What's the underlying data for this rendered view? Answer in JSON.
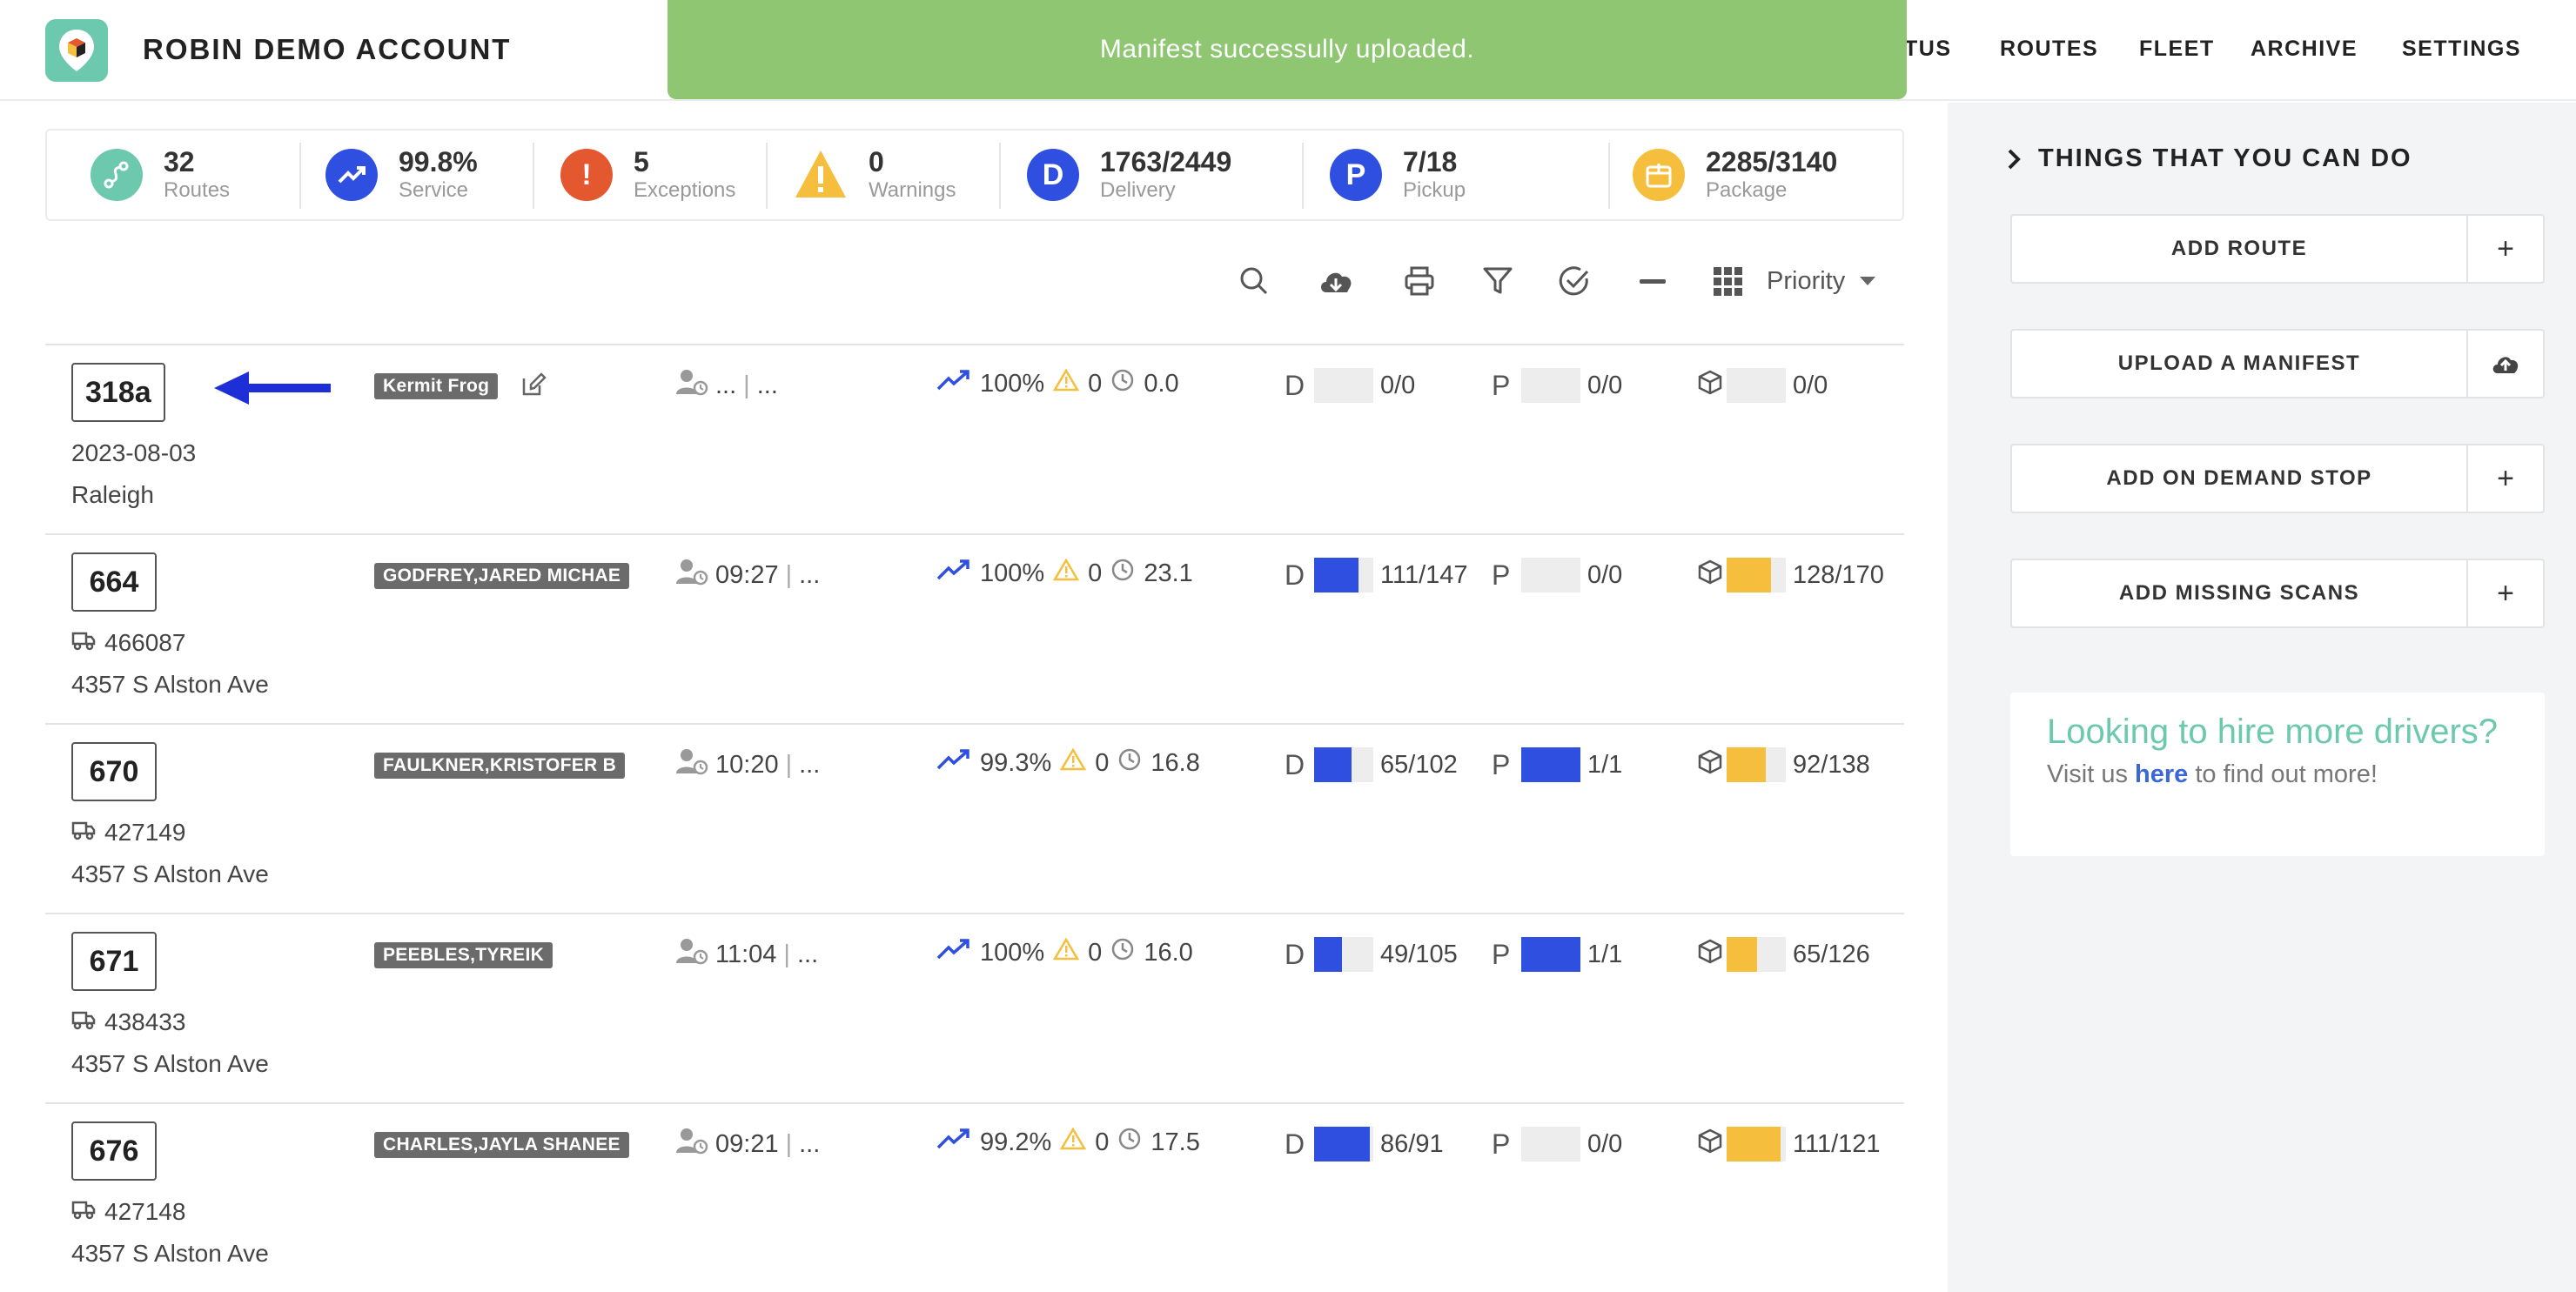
{
  "header": {
    "brand": "ROBIN DEMO ACCOUNT",
    "nav": [
      "TUS",
      "ROUTES",
      "FLEET",
      "ARCHIVE",
      "SETTINGS"
    ]
  },
  "toast": {
    "message": "Manifest successully uploaded."
  },
  "stats": [
    {
      "value": "32",
      "label": "Routes",
      "icon": "route-icon",
      "color": "#6cc9ad"
    },
    {
      "value": "99.8%",
      "label": "Service",
      "icon": "trend-up-icon",
      "color": "#2f4fe0"
    },
    {
      "value": "5",
      "label": "Exceptions",
      "icon": "exclamation-icon",
      "color": "#e4582f"
    },
    {
      "value": "0",
      "label": "Warnings",
      "icon": "warning-icon",
      "color": "#f5be3c"
    },
    {
      "value": "1763/2449",
      "label": "Delivery",
      "icon": "delivery-d-icon",
      "color": "#2f4fe0",
      "glyph": "D"
    },
    {
      "value": "7/18",
      "label": "Pickup",
      "icon": "pickup-p-icon",
      "color": "#2f4fe0",
      "glyph": "P"
    },
    {
      "value": "2285/3140",
      "label": "Package",
      "icon": "package-icon",
      "color": "#f5be3c"
    }
  ],
  "toolbar": {
    "icons": [
      "search-icon",
      "cloud-download-icon",
      "print-icon",
      "filter-icon",
      "check-circle-icon",
      "minus-icon",
      "grid-icon"
    ],
    "sort_label": "Priority"
  },
  "routes": [
    {
      "id": "318a",
      "line1": "2023-08-03",
      "line1_has_truck": false,
      "line2": "Raleigh",
      "driver": "Kermit Frog",
      "editable": true,
      "time": "...",
      "perf": "100%",
      "warn": "0",
      "dur": "0.0",
      "d_text": "0/0",
      "d_fill": 0,
      "p_text": "0/0",
      "p_fill": 0,
      "pkg_text": "0/0",
      "pkg_fill": 0
    },
    {
      "id": "664",
      "line1": "466087",
      "line1_has_truck": true,
      "line2": "4357 S Alston Ave",
      "driver": "GODFREY,JARED MICHAE",
      "editable": false,
      "time": "09:27",
      "perf": "100%",
      "warn": "0",
      "dur": "23.1",
      "d_text": "111/147",
      "d_fill": 0.755,
      "p_text": "0/0",
      "p_fill": 0,
      "pkg_text": "128/170",
      "pkg_fill": 0.753
    },
    {
      "id": "670",
      "line1": "427149",
      "line1_has_truck": true,
      "line2": "4357 S Alston Ave",
      "driver": "FAULKNER,KRISTOFER B",
      "editable": false,
      "time": "10:20",
      "perf": "99.3%",
      "warn": "0",
      "dur": "16.8",
      "d_text": "65/102",
      "d_fill": 0.637,
      "p_text": "1/1",
      "p_fill": 1,
      "pkg_text": "92/138",
      "pkg_fill": 0.667
    },
    {
      "id": "671",
      "line1": "438433",
      "line1_has_truck": true,
      "line2": "4357 S Alston Ave",
      "driver": "PEEBLES,TYREIK",
      "editable": false,
      "time": "11:04",
      "perf": "100%",
      "warn": "0",
      "dur": "16.0",
      "d_text": "49/105",
      "d_fill": 0.467,
      "p_text": "1/1",
      "p_fill": 1,
      "pkg_text": "65/126",
      "pkg_fill": 0.516
    },
    {
      "id": "676",
      "line1": "427148",
      "line1_has_truck": true,
      "line2": "4357 S Alston Ave",
      "driver": "CHARLES,JAYLA SHANEE",
      "editable": false,
      "time": "09:21",
      "perf": "99.2%",
      "warn": "0",
      "dur": "17.5",
      "d_text": "86/91",
      "d_fill": 0.945,
      "p_text": "0/0",
      "p_fill": 0,
      "pkg_text": "111/121",
      "pkg_fill": 0.917
    }
  ],
  "row_labels": {
    "delivery": "D",
    "pickup": "P",
    "ellipsis": "..."
  },
  "colors": {
    "accent": "#6cc9ad",
    "blue": "#2f4fe0",
    "yellow": "#f5be3c",
    "toast": "#8fc672"
  },
  "panel": {
    "title": "THINGS THAT YOU CAN DO",
    "actions": [
      {
        "label": "ADD ROUTE",
        "icon": "plus-icon"
      },
      {
        "label": "UPLOAD A MANIFEST",
        "icon": "cloud-upload-icon"
      },
      {
        "label": "ADD ON DEMAND STOP",
        "icon": "plus-icon"
      },
      {
        "label": "ADD MISSING SCANS",
        "icon": "plus-icon"
      }
    ],
    "hire_title": "Looking to hire more drivers?",
    "hire_pre": "Visit us",
    "hire_link": "here",
    "hire_post": "to find out more!"
  }
}
